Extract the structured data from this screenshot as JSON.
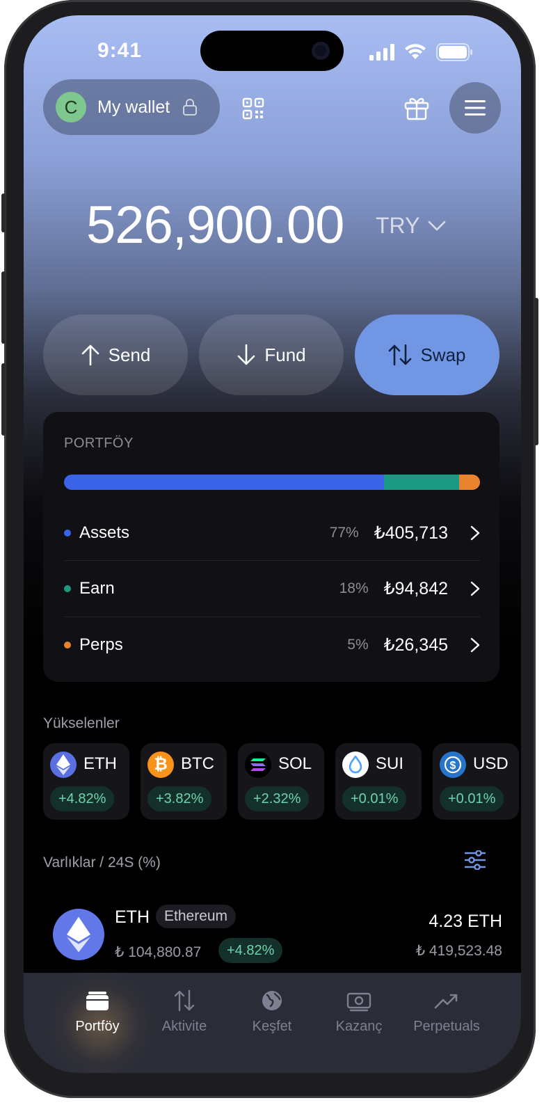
{
  "status": {
    "time": "9:41"
  },
  "header": {
    "avatar_letter": "C",
    "wallet_name": "My wallet"
  },
  "balance": {
    "amount": "526,900.00",
    "currency": "TRY"
  },
  "actions": [
    {
      "label": "Send",
      "icon": "arrow-up-icon"
    },
    {
      "label": "Fund",
      "icon": "arrow-down-icon"
    },
    {
      "label": "Swap",
      "icon": "swap-icon"
    }
  ],
  "portfolio": {
    "title": "PORTFÖY",
    "allocation": [
      {
        "name": "Assets",
        "percent": 77,
        "color": "#3b63e8"
      },
      {
        "name": "Earn",
        "percent": 18,
        "color": "#1a9a82"
      },
      {
        "name": "Perps",
        "percent": 5,
        "color": "#ea832e"
      }
    ],
    "rows": [
      {
        "name": "Assets",
        "pct": "77%",
        "amount": "₺405,713",
        "color": "#3b63e8"
      },
      {
        "name": "Earn",
        "pct": "18%",
        "amount": "₺94,842",
        "color": "#1a9a82"
      },
      {
        "name": "Perps",
        "pct": "5%",
        "amount": "₺26,345",
        "color": "#ea832e"
      }
    ]
  },
  "gainers": {
    "title": "Yükselenler",
    "items": [
      {
        "symbol": "ETH",
        "change": "+4.82%",
        "color": "#5a6fe0",
        "icon": "eth-icon"
      },
      {
        "symbol": "BTC",
        "change": "+3.82%",
        "color": "#f7931a",
        "icon": "btc-icon"
      },
      {
        "symbol": "SOL",
        "change": "+2.32%",
        "color": "#000000",
        "icon": "sol-icon"
      },
      {
        "symbol": "SUI",
        "change": "+0.01%",
        "color": "#ffffff",
        "icon": "sui-icon"
      },
      {
        "symbol": "USD",
        "change": "+0.01%",
        "color": "#2775ca",
        "icon": "usdc-icon"
      }
    ]
  },
  "assets": {
    "title": "Varlıklar / 24S (%)",
    "items": [
      {
        "symbol": "ETH",
        "name": "Ethereum",
        "price": "₺ 104,880.87",
        "change": "+4.82%",
        "quantity": "4.23 ETH",
        "value": "₺ 419,523.48"
      }
    ]
  },
  "tabs": [
    {
      "label": "Portföy",
      "icon": "wallet-icon",
      "active": true
    },
    {
      "label": "Aktivite",
      "icon": "activity-icon",
      "active": false
    },
    {
      "label": "Keşfet",
      "icon": "globe-icon",
      "active": false
    },
    {
      "label": "Kazanç",
      "icon": "cash-icon",
      "active": false
    },
    {
      "label": "Perpetuals",
      "icon": "trend-icon",
      "active": false
    }
  ]
}
